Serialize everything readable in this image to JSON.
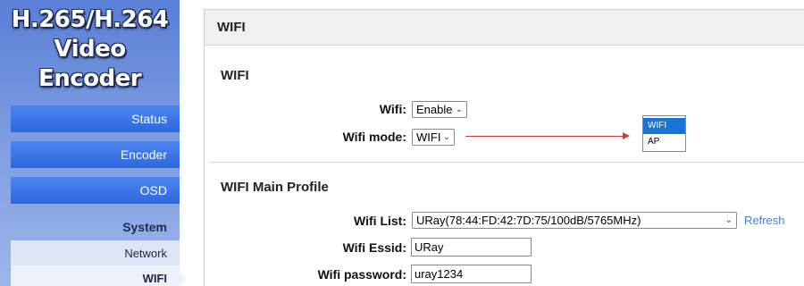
{
  "sidebar": {
    "logo_line1": "H.265/H.264",
    "logo_line2": "Video Encoder",
    "items": [
      {
        "label": "Status"
      },
      {
        "label": "Encoder"
      },
      {
        "label": "OSD"
      }
    ],
    "section_label": "System",
    "sub_items": [
      {
        "label": "Network"
      },
      {
        "label": "WIFI"
      }
    ]
  },
  "panel": {
    "header_title": "WIFI",
    "wifi_section": {
      "title": "WIFI",
      "wifi_label": "Wifi:",
      "wifi_value": "Enable",
      "mode_label": "Wifi mode:",
      "mode_value": "WIFI",
      "mode_options": [
        "WIFI",
        "AP"
      ],
      "mode_selected_option": "WIFI"
    },
    "main_profile": {
      "title": "WIFI Main Profile",
      "list_label": "Wifi List:",
      "list_value": "URay(78:44:FD:42:7D:75/100dB/5765MHz)",
      "refresh_label": "Refresh",
      "essid_label": "Wifi Essid:",
      "essid_value": "URay",
      "password_label": "Wifi password:",
      "password_value": "uray1234"
    }
  },
  "colors": {
    "nav_button": "#3a74e6",
    "annotation_arrow": "#d23a3a",
    "selected_option": "#1874d6",
    "link": "#4a7fc6"
  },
  "icons": {
    "select_chevron": "chevron-down-icon"
  }
}
